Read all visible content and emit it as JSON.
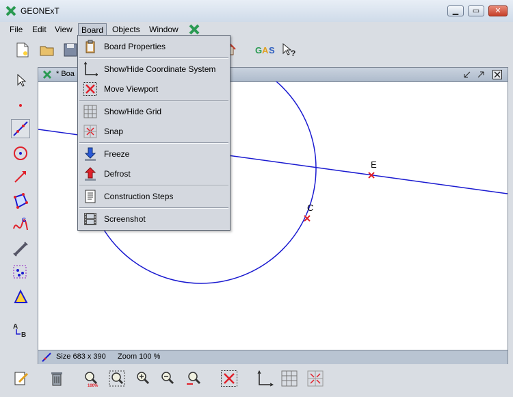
{
  "app": {
    "title": "GEONExT"
  },
  "menubar": [
    "File",
    "Edit",
    "View",
    "Board",
    "Objects",
    "Window"
  ],
  "board_menu": {
    "items": [
      {
        "label": "Board Properties",
        "icon": "clipboard-icon"
      },
      {
        "label": "Show/Hide Coordinate System",
        "icon": "axes-icon"
      },
      {
        "label": "Move Viewport",
        "icon": "move-viewport-icon"
      },
      {
        "label": "Show/Hide Grid",
        "icon": "grid-icon"
      },
      {
        "label": "Snap",
        "icon": "snap-icon"
      },
      {
        "label": "Freeze",
        "icon": "freeze-arrow-icon"
      },
      {
        "label": "Defrost",
        "icon": "defrost-arrow-icon"
      },
      {
        "label": "Construction Steps",
        "icon": "steps-icon"
      },
      {
        "label": "Screenshot",
        "icon": "filmstrip-icon"
      }
    ]
  },
  "board_window": {
    "title": "* Boa"
  },
  "canvas": {
    "point_labels": [
      "E",
      "C"
    ]
  },
  "statusbar": {
    "size": "Size 683 x 390",
    "zoom": "Zoom 100 %"
  },
  "colors": {
    "construction": "#1a1ad0",
    "point": "#e0202a",
    "menu_bg": "#d4d8df"
  }
}
